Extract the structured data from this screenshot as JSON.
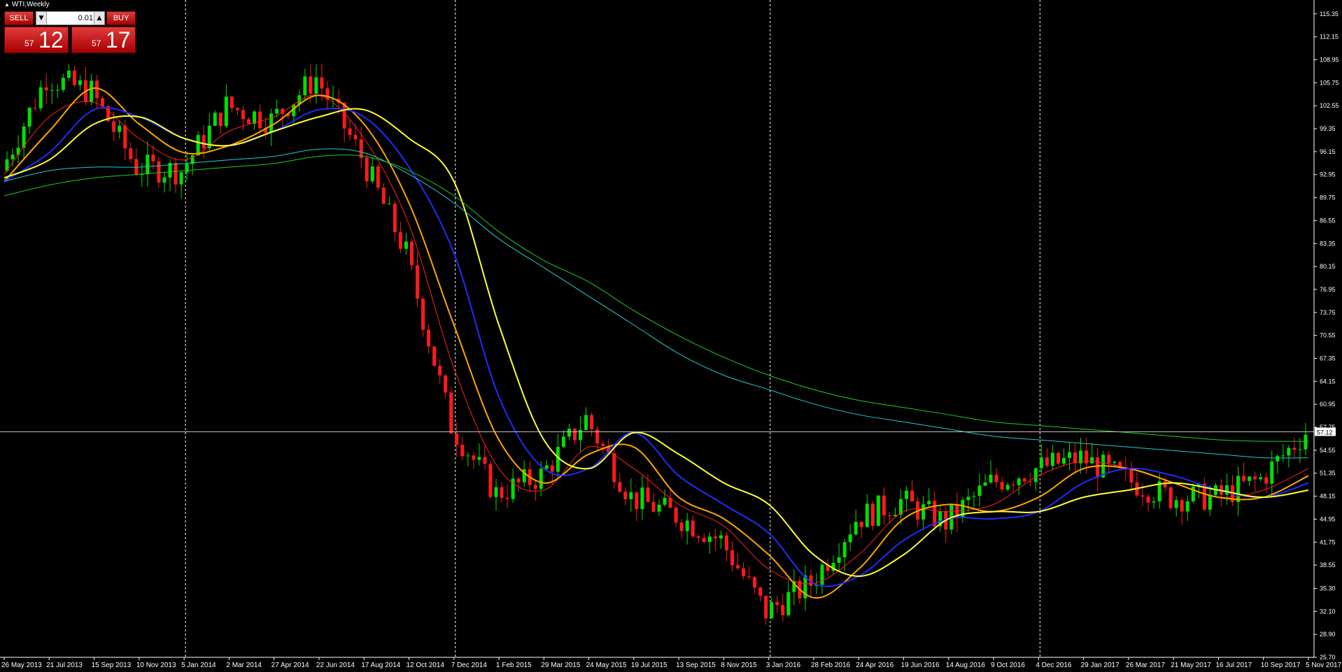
{
  "window": {
    "title": "WTI,Weekly"
  },
  "trade_panel": {
    "sell_label": "SELL",
    "buy_label": "BUY",
    "lot_size": "0.01",
    "sell_price_small": "57",
    "sell_price_big": "12",
    "buy_price_small": "57",
    "buy_price_big": "17"
  },
  "colors": {
    "background": "#000000",
    "bull_candle": "#00e000",
    "bear_candle": "#ff1a1a",
    "ma_red": "#ff2020",
    "ma_orange": "#ffa500",
    "ma_blue": "#1f2bff",
    "ma_yellow": "#ffff33",
    "ma_teal": "#22cccc",
    "ma_green": "#22cc22",
    "current_price_line": "#c0c0c0"
  },
  "chart_data": {
    "type": "candlestick",
    "symbol": "WTI",
    "timeframe": "Weekly",
    "ylim": [
      25.7,
      116.5
    ],
    "current_price": 57.12,
    "current_price_label": "57.12",
    "grid": false,
    "y_ticks": [
      "115.35",
      "112.15",
      "108.95",
      "105.75",
      "102.55",
      "99.35",
      "96.15",
      "92.95",
      "89.75",
      "86.55",
      "83.35",
      "80.15",
      "76.95",
      "73.75",
      "70.55",
      "67.35",
      "64.15",
      "60.95",
      "57.75",
      "54.55",
      "51.35",
      "48.15",
      "44.95",
      "41.75",
      "38.55",
      "35.30",
      "32.10",
      "28.90",
      "25.70"
    ],
    "x_labels": [
      "26 May 2013",
      "21 Jul 2013",
      "15 Sep 2013",
      "10 Nov 2013",
      "5 Jan 2014",
      "2 Mar 2014",
      "27 Apr 2014",
      "22 Jun 2014",
      "17 Aug 2014",
      "12 Oct 2014",
      "7 Dec 2014",
      "1 Feb 2015",
      "29 Mar 2015",
      "24 May 2015",
      "19 Jul 2015",
      "13 Sep 2015",
      "8 Nov 2015",
      "3 Jan 2016",
      "28 Feb 2016",
      "24 Apr 2016",
      "19 Jun 2016",
      "14 Aug 2016",
      "9 Oct 2016",
      "4 Dec 2016",
      "29 Jan 2017",
      "26 Mar 2017",
      "21 May 2017",
      "16 Jul 2017",
      "10 Sep 2017",
      "5 Nov 2017"
    ],
    "year_separators": [
      "5 Jan 2014",
      "7 Dec 2014",
      "3 Jan 2016",
      "4 Dec 2016"
    ],
    "close_series": [
      {
        "date": "26 May 2013",
        "close": 93.5
      },
      {
        "date": "21 Jul 2013",
        "close": 106.5
      },
      {
        "date": "15 Sep 2013",
        "close": 104.5
      },
      {
        "date": "10 Nov 2013",
        "close": 94.0
      },
      {
        "date": "5 Jan 2014",
        "close": 93.5
      },
      {
        "date": "2 Mar 2014",
        "close": 102.5
      },
      {
        "date": "27 Apr 2014",
        "close": 100.5
      },
      {
        "date": "22 Jun 2014",
        "close": 106.5
      },
      {
        "date": "17 Aug 2014",
        "close": 95.5
      },
      {
        "date": "12 Oct 2014",
        "close": 82.0
      },
      {
        "date": "7 Dec 2014",
        "close": 58.0
      },
      {
        "date": "1 Feb 2015",
        "close": 48.5
      },
      {
        "date": "29 Mar 2015",
        "close": 51.0
      },
      {
        "date": "24 May 2015",
        "close": 59.0
      },
      {
        "date": "19 Jul 2015",
        "close": 48.0
      },
      {
        "date": "13 Sep 2015",
        "close": 45.5
      },
      {
        "date": "8 Nov 2015",
        "close": 42.0
      },
      {
        "date": "3 Jan 2016",
        "close": 32.0
      },
      {
        "date": "28 Feb 2016",
        "close": 36.0
      },
      {
        "date": "24 Apr 2016",
        "close": 45.0
      },
      {
        "date": "19 Jun 2016",
        "close": 47.5
      },
      {
        "date": "14 Aug 2016",
        "close": 44.5
      },
      {
        "date": "9 Oct 2016",
        "close": 50.0
      },
      {
        "date": "4 Dec 2016",
        "close": 52.0
      },
      {
        "date": "29 Jan 2017",
        "close": 53.5
      },
      {
        "date": "26 Mar 2017",
        "close": 50.5
      },
      {
        "date": "21 May 2017",
        "close": 48.0
      },
      {
        "date": "16 Jul 2017",
        "close": 48.0
      },
      {
        "date": "10 Sep 2017",
        "close": 50.5
      },
      {
        "date": "5 Nov 2017",
        "close": 57.1
      }
    ],
    "moving_averages": [
      {
        "color": "red",
        "values": [
          93,
          101,
          103,
          98,
          95,
          99,
          101,
          104,
          98,
          86,
          66,
          52,
          49,
          55,
          52,
          47,
          44,
          38,
          36,
          40,
          46,
          46,
          47,
          51,
          53,
          52,
          50,
          48,
          49,
          52
        ]
      },
      {
        "color": "orange",
        "values": [
          92,
          99,
          105,
          100,
          96,
          97,
          100,
          104,
          100,
          89,
          72,
          56,
          50,
          54,
          55,
          48,
          45,
          40,
          34,
          38,
          45,
          47,
          46,
          48,
          52,
          52,
          50,
          48,
          48,
          51
        ]
      },
      {
        "color": "blue",
        "values": [
          92,
          96,
          102,
          101,
          98,
          97,
          99,
          102,
          101,
          94,
          82,
          62,
          52,
          52,
          57,
          51,
          47,
          43,
          36,
          37,
          42,
          45,
          45,
          46,
          50,
          52,
          51,
          49,
          48,
          50
        ]
      },
      {
        "color": "yellow",
        "values": [
          92.5,
          95,
          100,
          101,
          98,
          97,
          99,
          101,
          102,
          98,
          92,
          72,
          56,
          52,
          57,
          54,
          50,
          47,
          40,
          37,
          40,
          45,
          46,
          46,
          48,
          49,
          50,
          49,
          48,
          49
        ]
      },
      {
        "color": "teal",
        "values": [
          92,
          93.5,
          94,
          94,
          94.5,
          95,
          95.5,
          96.5,
          96,
          93,
          89,
          84,
          80,
          76,
          72,
          68,
          65,
          63,
          61,
          59.5,
          58.5,
          57.5,
          56.5,
          56,
          55.5,
          55,
          54.5,
          54,
          53.5,
          53.5
        ]
      },
      {
        "color": "green",
        "values": [
          90,
          91.5,
          92.5,
          93,
          93.5,
          94,
          94.5,
          95.5,
          95.5,
          93.5,
          90,
          85,
          81,
          78,
          74,
          70.5,
          67.5,
          65,
          63,
          61.5,
          60.5,
          59.5,
          58.5,
          58,
          57.5,
          57,
          56.5,
          56,
          55.8,
          55.8
        ]
      }
    ]
  }
}
